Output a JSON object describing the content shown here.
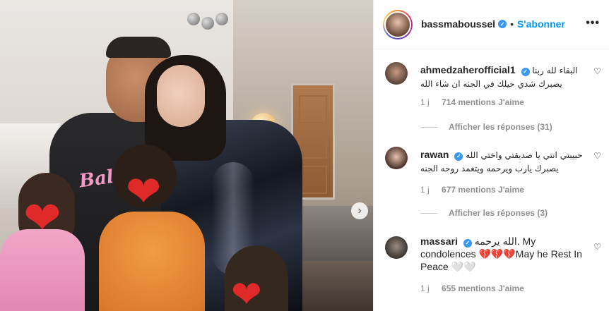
{
  "post": {
    "photo": {
      "shirt_text": "Bale",
      "next_icon": "chevron-right-icon"
    },
    "header": {
      "username": "bassmaboussel",
      "verified_mark": "✓",
      "separator": "•",
      "follow_label": "S'abonner",
      "more_label": "•••"
    },
    "comments": [
      {
        "username": "ahmedzaherofficial1",
        "text_lines": [
          "البقاء لله ربنا",
          "يصبرك شدي حيلك في الجنه ان شاء الله"
        ],
        "time": "1 j",
        "likes": "714 mentions J'aime",
        "replies_label": "Afficher les réponses (31)"
      },
      {
        "username": "rawan",
        "text_lines": [
          "حبيبتي انتي يا صديقتي واختي الله",
          "يصبرك يارب ويرحمه ويتغمد روحه الجنه"
        ],
        "time": "1 j",
        "likes": "677 mentions J'aime",
        "replies_label": "Afficher les réponses (3)"
      },
      {
        "username": "massari",
        "text_lines": [
          "الله يرحمه. My",
          "condolences 💔💔💔May he Rest In",
          "Peace 🤍🤍"
        ],
        "time": "1 j",
        "likes": "655 mentions J'aime"
      }
    ],
    "colors": {
      "link_blue": "#0095f6",
      "verified_blue": "#3897f0",
      "heart_red": "#e02a2a",
      "muted_text": "#8e8e8e"
    },
    "icons": {
      "like": "heart-outline-icon",
      "face_cover": "red-heart-emoji-icon"
    }
  }
}
